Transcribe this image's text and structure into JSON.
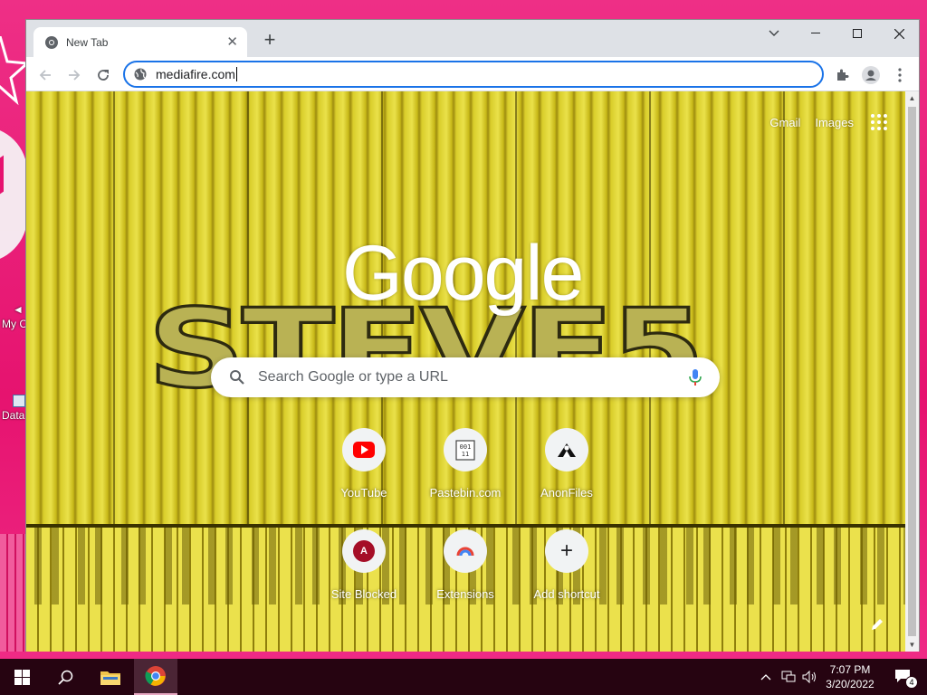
{
  "desktop": {
    "icons": [
      {
        "label": "My C"
      },
      {
        "label": "Data"
      }
    ]
  },
  "browser": {
    "tab": {
      "title": "New Tab",
      "close_glyph": "✕"
    },
    "new_tab_glyph": "+",
    "window_controls": {
      "dropdown": "chevron-down-icon",
      "minimize": "minimize-icon",
      "maximize": "maximize-icon",
      "close": "close-icon"
    },
    "omnibox": {
      "value": "mediafire.com"
    },
    "toolbar_icons": [
      "back-icon",
      "forward-icon",
      "reload-icon",
      "extensions-icon",
      "profile-icon",
      "menu-icon"
    ]
  },
  "ntp": {
    "background_text": "STEVE5",
    "top_links": {
      "gmail": "Gmail",
      "images": "Images"
    },
    "logo": "Google",
    "search": {
      "placeholder": "Search Google or type a URL"
    },
    "shortcuts": [
      {
        "label": "YouTube",
        "icon": "youtube-icon"
      },
      {
        "label": "Pastebin.com",
        "icon": "pastebin-icon"
      },
      {
        "label": "AnonFiles",
        "icon": "anonfiles-icon"
      },
      {
        "label": "Site Blocked",
        "icon": "site-blocked-icon",
        "letter": "A"
      },
      {
        "label": "Extensions",
        "icon": "extensions-shortcut-icon"
      },
      {
        "label": "Add shortcut",
        "icon": "add-icon",
        "glyph": "+"
      }
    ]
  },
  "taskbar": {
    "clock": {
      "time": "7:07 PM",
      "date": "3/20/2022"
    },
    "notification_count": "4"
  },
  "colors": {
    "desktop": "#ea1e7e",
    "taskbar": "#260411",
    "accent": "#1a73e8",
    "ntp_bg": "#d9cd2a"
  }
}
